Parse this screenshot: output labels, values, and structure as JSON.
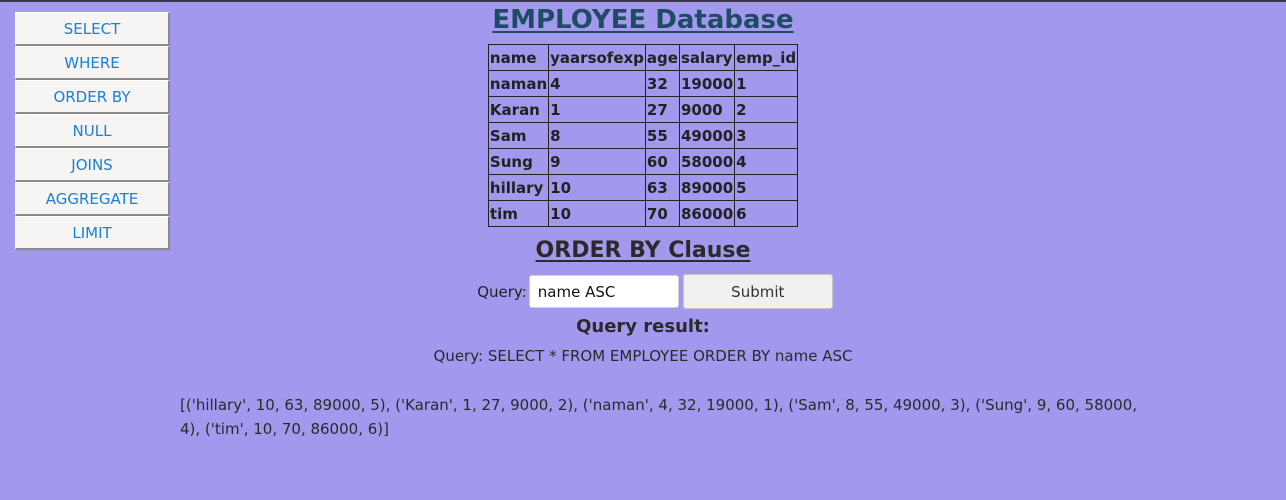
{
  "sidebar": {
    "items": [
      {
        "label": "SELECT"
      },
      {
        "label": "WHERE"
      },
      {
        "label": "ORDER BY"
      },
      {
        "label": "NULL"
      },
      {
        "label": "JOINS"
      },
      {
        "label": "AGGREGATE"
      },
      {
        "label": "LIMIT"
      }
    ]
  },
  "main": {
    "title": "EMPLOYEE Database",
    "table": {
      "headers": [
        "name",
        "yaarsofexp",
        "age",
        "salary",
        "emp_id"
      ],
      "rows": [
        [
          "naman",
          "4",
          "32",
          "19000",
          "1"
        ],
        [
          "Karan",
          "1",
          "27",
          "9000",
          "2"
        ],
        [
          "Sam",
          "8",
          "55",
          "49000",
          "3"
        ],
        [
          "Sung",
          "9",
          "60",
          "58000",
          "4"
        ],
        [
          "hillary",
          "10",
          "63",
          "89000",
          "5"
        ],
        [
          "tim",
          "10",
          "70",
          "86000",
          "6"
        ]
      ]
    },
    "section_title": "ORDER BY Clause",
    "query_form": {
      "label": "Query:",
      "input_value": "name ASC",
      "submit_label": "Submit"
    },
    "result_title": "Query result:",
    "query_text": "Query: SELECT * FROM EMPLOYEE ORDER BY name ASC",
    "result_data": "[('hillary', 10, 63, 89000, 5), ('Karan', 1, 27, 9000, 2), ('naman', 4, 32, 19000, 1), ('Sam', 8, 55, 49000, 3), ('Sung', 9, 60, 58000, 4), ('tim', 10, 70, 86000, 6)]"
  },
  "colors": {
    "background": "#a299ef",
    "title": "#1e4d63",
    "nav_link": "#1a7fd6"
  }
}
